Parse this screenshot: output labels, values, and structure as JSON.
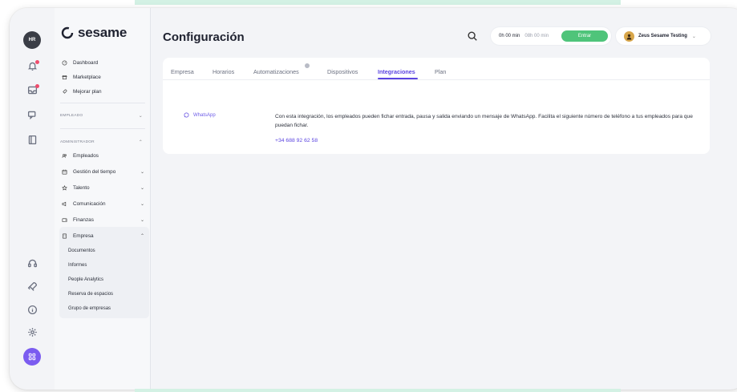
{
  "brand": {
    "logo_text": "sesame",
    "accent": "#5b45e0",
    "green": "#4fc47a",
    "mint": "#d3f1e4"
  },
  "rail": {
    "avatar_initials": "HR",
    "icons": [
      "bell-icon",
      "inbox-icon",
      "chat-icon",
      "book-icon",
      "headset-icon",
      "rocket-icon",
      "info-icon",
      "gear-icon",
      "apps-icon"
    ]
  },
  "sidebar": {
    "top_items": [
      {
        "label": "Dashboard",
        "icon": "dashboard-icon"
      },
      {
        "label": "Marketplace",
        "icon": "marketplace-icon"
      },
      {
        "label": "Mejorar plan",
        "icon": "rocket-icon"
      }
    ],
    "section_empleado": "EMPLEADO",
    "section_administrador": "ADMINISTRADOR",
    "admin_items": [
      {
        "label": "Empleados",
        "icon": "users-icon",
        "expandable": false
      },
      {
        "label": "Gestión del tiempo",
        "icon": "calendar-icon",
        "expandable": true
      },
      {
        "label": "Talento",
        "icon": "star-icon",
        "expandable": true
      },
      {
        "label": "Comunicación",
        "icon": "megaphone-icon",
        "expandable": true
      },
      {
        "label": "Finanzas",
        "icon": "wallet-icon",
        "expandable": true
      },
      {
        "label": "Empresa",
        "icon": "building-icon",
        "expandable": true,
        "expanded": true
      }
    ],
    "empresa_sub": [
      "Documentos",
      "Informes",
      "People Analytics",
      "Reserva de espacios",
      "Grupo de empresas"
    ]
  },
  "header": {
    "title": "Configuración",
    "timer_worked": "0h 00 min",
    "timer_total": "08h 00 min",
    "entrar_label": "Entrar",
    "user_name": "Zeus Sesame Testing"
  },
  "tabs": [
    {
      "label": "Empresa",
      "active": false
    },
    {
      "label": "Horarios",
      "active": false
    },
    {
      "label": "Automatizaciones",
      "active": false
    },
    {
      "label": "Dispositivos",
      "active": false
    },
    {
      "label": "Integraciones",
      "active": true
    },
    {
      "label": "Plan",
      "active": false
    }
  ],
  "integration": {
    "name": "WhatsApp",
    "description": "Con esta integración, los empleados pueden fichar entrada, pausa y salida enviando un mensaje de WhatsApp. Facilita el siguiente número de teléfono a tus empleados para que puedan fichar.",
    "phone": "+34 688 92 62 58"
  }
}
